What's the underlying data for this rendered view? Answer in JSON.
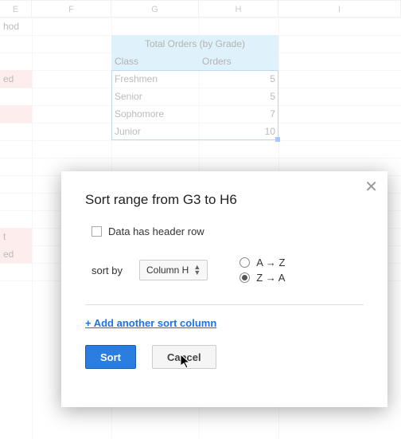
{
  "columns": {
    "E": "E",
    "F": "F",
    "G": "G",
    "H": "H",
    "I": "I"
  },
  "row1": {
    "hod": "hod"
  },
  "title_cell": "Total Orders (by Grade)",
  "table": {
    "headers": {
      "class": "Class",
      "orders": "Orders"
    },
    "rows": [
      {
        "class": "Freshmen",
        "orders": "5"
      },
      {
        "class": "Senior",
        "orders": "5"
      },
      {
        "class": "Sophomore",
        "orders": "7"
      },
      {
        "class": "Junior",
        "orders": "10"
      }
    ]
  },
  "row4": {
    "ed": "ed"
  },
  "row13": {
    "t": "t"
  },
  "row14": {
    "ed": "ed"
  },
  "dialog": {
    "title": "Sort range from G3 to H6",
    "header_row_label": "Data has header row",
    "sort_by_label": "sort by",
    "sort_column": "Column H",
    "az_label": "A → Z",
    "za_label": "Z → A",
    "add_column": "+ Add another sort column",
    "sort_btn": "Sort",
    "cancel_btn": "Cancel"
  }
}
